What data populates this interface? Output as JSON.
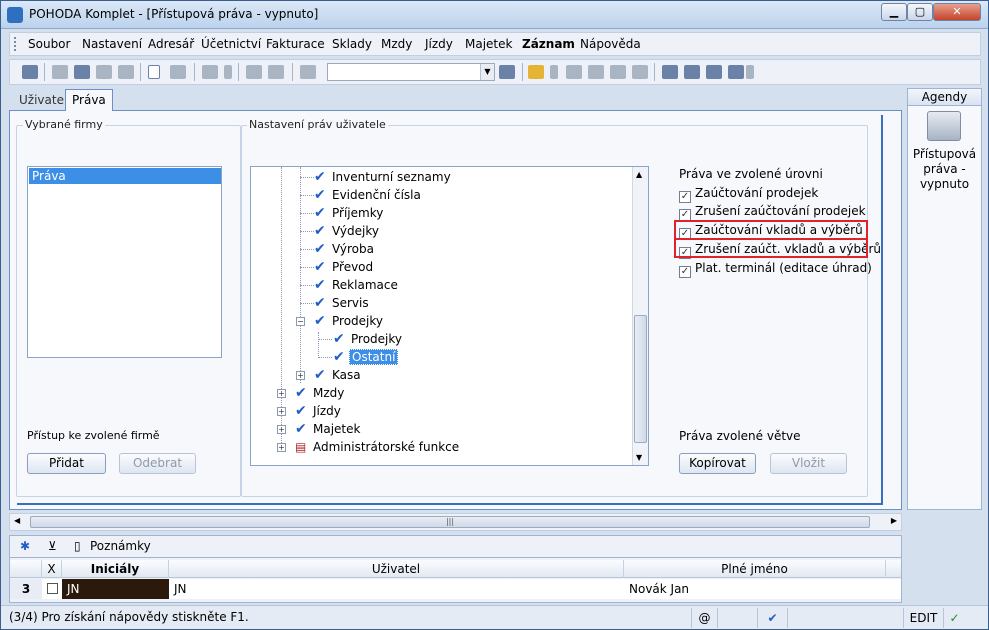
{
  "window": {
    "title": "POHODA Komplet - [Přístupová práva - vypnuto]"
  },
  "menu": [
    "Soubor",
    "Nastavení",
    "Adresář",
    "Účetnictví",
    "Fakturace",
    "Sklady",
    "Mzdy",
    "Jízdy",
    "Majetek",
    "Záznam",
    "Nápověda"
  ],
  "tabs": {
    "user": "Uživatel",
    "rights": "Práva"
  },
  "left": {
    "firms_label": "Vybrané firmy",
    "firm_selected": "Práva",
    "access_label": "Přístup ke zvolené firmě",
    "add_button": "Přidat",
    "remove_button": "Odebrat"
  },
  "settings": {
    "label": "Nastavení práv uživatele"
  },
  "tree": {
    "items": [
      "Inventurní seznamy",
      "Evidenční čísla",
      "Příjemky",
      "Výdejky",
      "Výroba",
      "Převod",
      "Reklamace",
      "Servis",
      "Prodejky",
      "Prodejky",
      "Ostatní",
      "Kasa",
      "Mzdy",
      "Jízdy",
      "Majetek",
      "Administrátorské funkce"
    ]
  },
  "rights": {
    "title": "Práva ve zvolené úrovni",
    "items": [
      "Zaúčtování prodejek",
      "Zrušení zaúčtování prodejek",
      "Zaúčtování vkladů a výběrů",
      "Zrušení zaúčt. vkladů a výběrů",
      "Plat. terminál (editace úhrad)"
    ],
    "branch_label": "Práva zvolené větve",
    "copy_button": "Kopírovat",
    "paste_button": "Vložit"
  },
  "agenda": {
    "header": "Agendy",
    "label": "Přístupová práva - vypnuto"
  },
  "bottom": {
    "tab_notes": "Poznámky",
    "columns": {
      "x": "X",
      "initials": "Iniciály",
      "user": "Uživatel",
      "fullname": "Plné jméno"
    },
    "row": {
      "num": "3",
      "initials": "JN",
      "user": "JN",
      "fullname": "Novák Jan"
    }
  },
  "status": {
    "text": "(3/4) Pro získání nápovědy stiskněte F1.",
    "mode": "EDIT"
  }
}
